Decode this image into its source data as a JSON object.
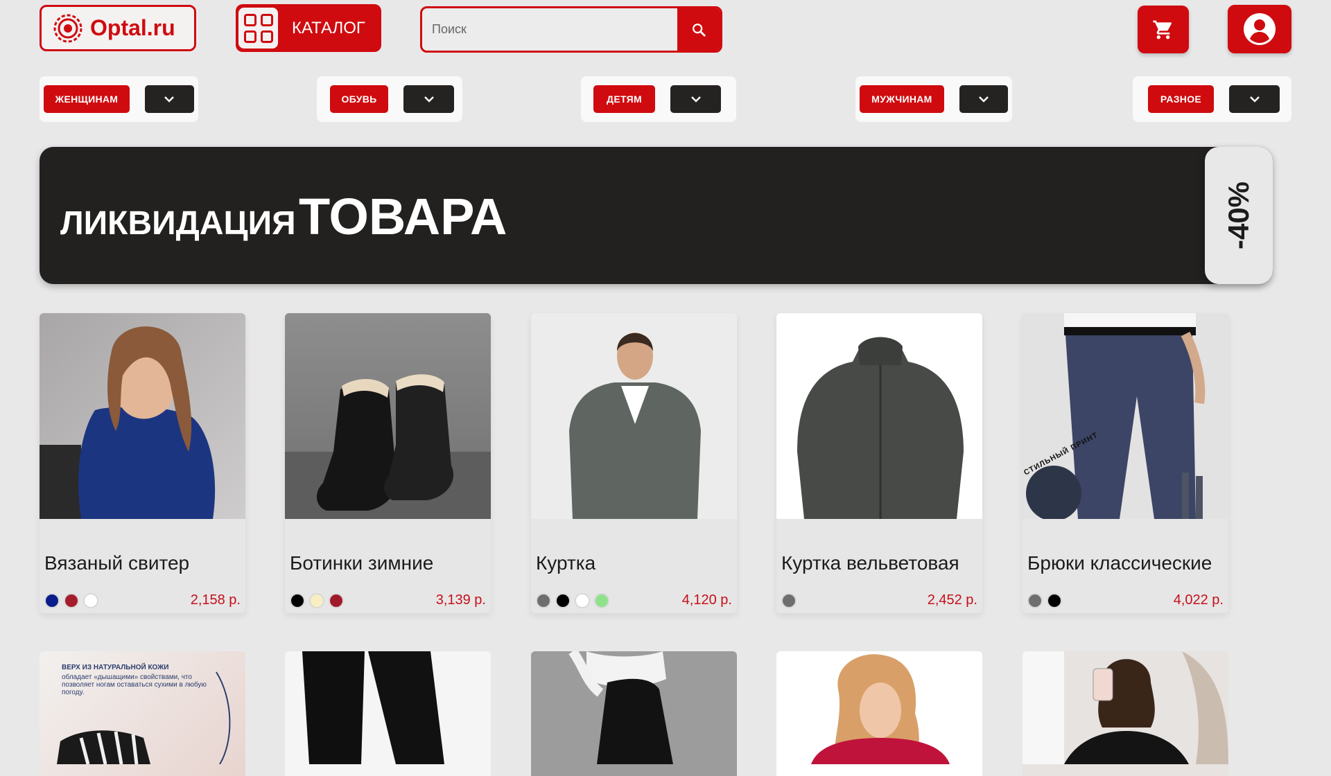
{
  "header": {
    "logo_text": "Optal.ru",
    "catalog_label": "КАТАЛОГ",
    "search_placeholder": "Поиск"
  },
  "categories": [
    {
      "label": "ЖЕНЩИНАМ"
    },
    {
      "label": "ОБУВЬ"
    },
    {
      "label": "ДЕТЯМ"
    },
    {
      "label": "МУЖЧИНАМ"
    },
    {
      "label": "РАЗНОЕ"
    }
  ],
  "banner": {
    "text_small": "ЛИКВИДАЦИЯ",
    "text_big": "ТОВАРА",
    "discount": "-40%"
  },
  "products": [
    {
      "name": "Вязаный свитер",
      "price": "2,158 р.",
      "colors": [
        "#0b1d8c",
        "#a51c2b",
        "#ffffff"
      ]
    },
    {
      "name": "Ботинки зимние",
      "price": "3,139 р.",
      "colors": [
        "#000000",
        "#f7efc2",
        "#a01b2a"
      ]
    },
    {
      "name": "Куртка",
      "price": "4,120 р.",
      "colors": [
        "#6e6e6e",
        "#000000",
        "#ffffff",
        "#8ee38a"
      ]
    },
    {
      "name": "Куртка вельветовая",
      "price": "2,452 р.",
      "colors": [
        "#6e6e6e"
      ]
    },
    {
      "name": "Брюки классические",
      "price": "4,022 р.",
      "colors": [
        "#6e6e6e",
        "#000000"
      ]
    }
  ],
  "promo_card": {
    "title": "ВЕРХ ИЗ НАТУРАЛЬНОЙ КОЖИ",
    "text": "обладает «дышащими» свойствами, что позволяет ногам оставаться сухими в любую погоду."
  },
  "print_badge": "СТИЛЬНЫЙ ПРИНТ",
  "colors": {
    "brand_red": "#cf0b0f",
    "dark": "#22211f",
    "background": "#e9e8e9"
  }
}
